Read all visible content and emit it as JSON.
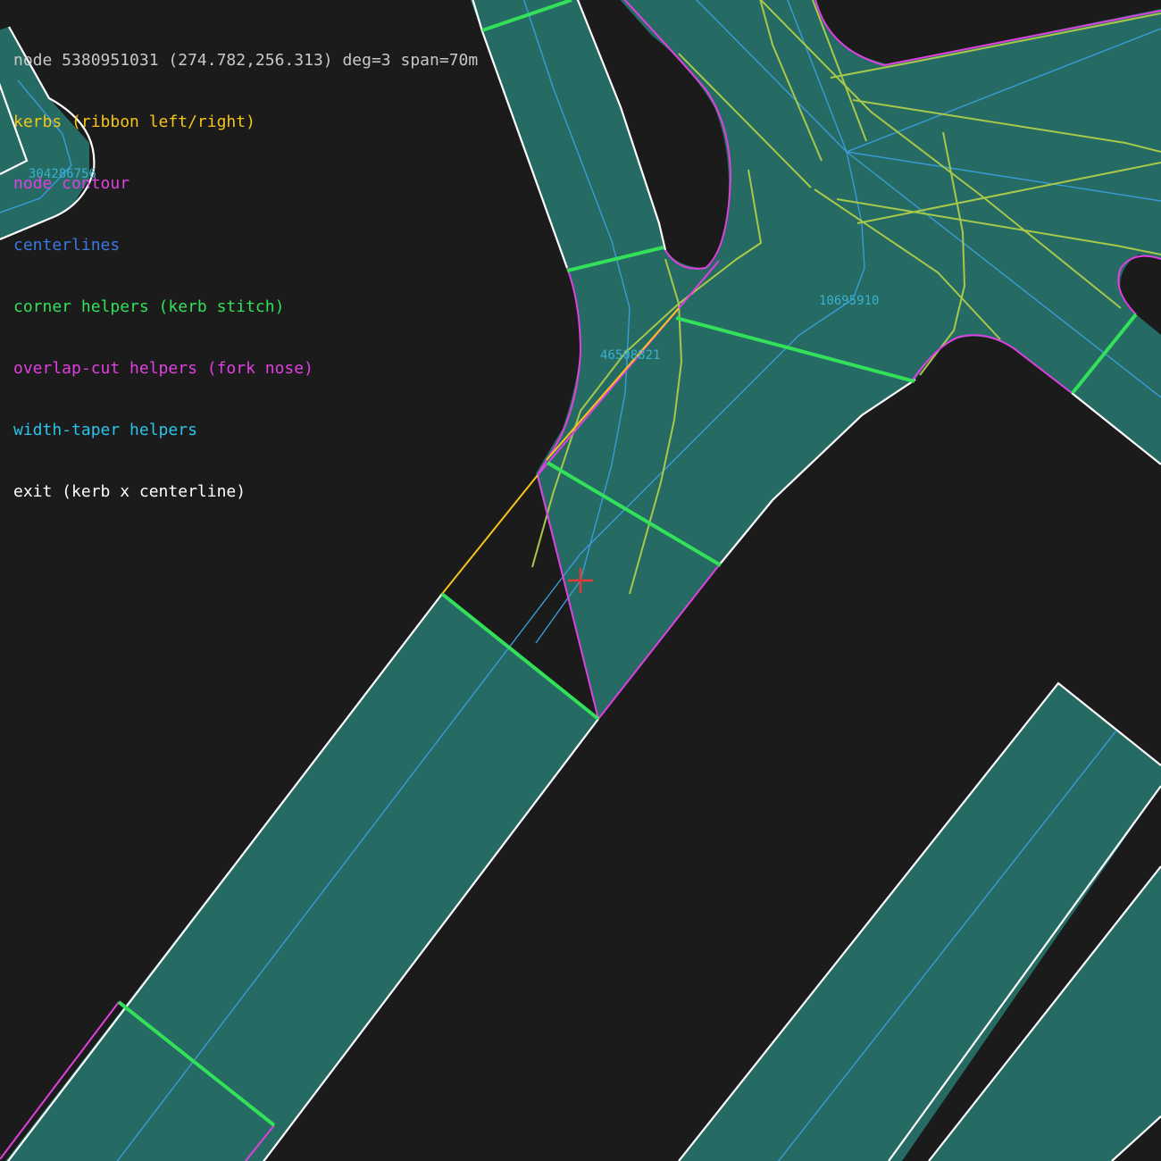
{
  "header": {
    "text": "node 5380951031 (274.782,256.313) deg=3 span=70m"
  },
  "legend": [
    {
      "label": "kerbs (ribbon left/right)",
      "color": "#f5c518"
    },
    {
      "label": "node contour",
      "color": "#e040e0"
    },
    {
      "label": "centerlines",
      "color": "#3a78e0"
    },
    {
      "label": "corner helpers (kerb stitch)",
      "color": "#33e05a"
    },
    {
      "label": "overlap-cut helpers (fork nose)",
      "color": "#e040e0"
    },
    {
      "label": "width-taper helpers",
      "color": "#2ac4e8"
    },
    {
      "label": "exit (kerb x centerline)",
      "color": "#ffffff"
    }
  ],
  "way_labels": {
    "w1": "304286756",
    "w2": "46508821",
    "w3": "10695910"
  },
  "colors": {
    "background": "#1b1b1b",
    "road_fill": "#256b63",
    "road_edge": "#ffffff",
    "node_marker": "#e53935",
    "helper_olive": "#a8c84a",
    "centerline": "#3a9bd8"
  }
}
